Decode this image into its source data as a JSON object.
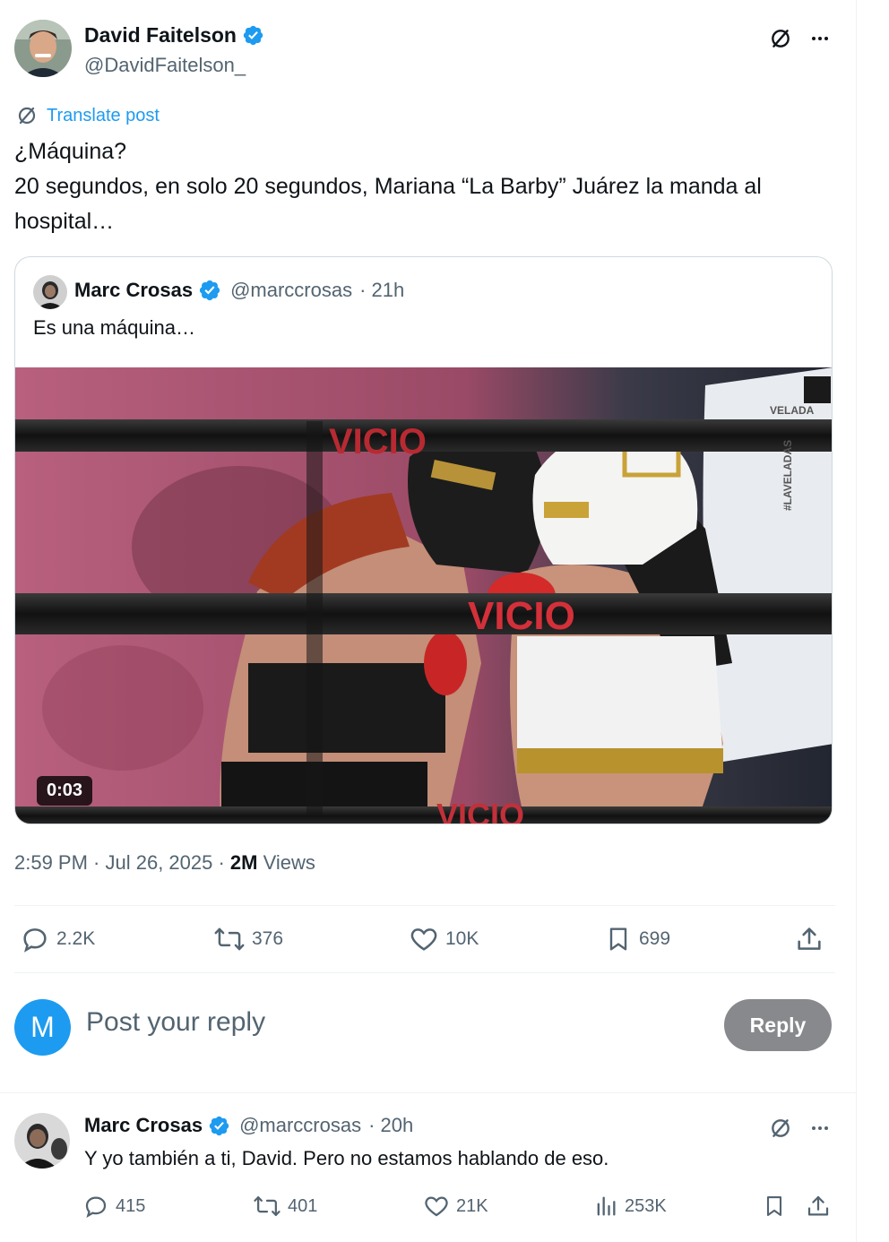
{
  "post": {
    "author_name": "David Faitelson",
    "author_handle": "@DavidFaitelson_",
    "translate_label": "Translate post",
    "text_line1": "¿Máquina?",
    "text_line2": "20 segundos, en solo 20 segundos, Mariana “La Barby” Juárez la manda al hospital…",
    "timestamp": "2:59 PM · Jul 26, 2025 · ",
    "views_count": "2M",
    "views_label": " Views"
  },
  "quote": {
    "author_name": "Marc Crosas",
    "author_handle": "@marccrosas",
    "time": "· 21h",
    "text": "Es una máquina…",
    "video_duration": "0:03",
    "video_banner_text": "VICIO",
    "video_tag": "#LAVELADAS",
    "video_logo": "VELADA"
  },
  "actions": {
    "replies": "2.2K",
    "reposts": "376",
    "likes": "10K",
    "bookmarks": "699"
  },
  "reply_compose": {
    "avatar_letter": "M",
    "placeholder": "Post your reply",
    "button_label": "Reply"
  },
  "comment": {
    "author_name": "Marc Crosas",
    "author_handle": "@marccrosas",
    "time": "· 20h",
    "text": "Y yo también a ti, David. Pero no estamos hablando de eso.",
    "replies": "415",
    "reposts": "401",
    "likes": "21K",
    "views": "253K"
  },
  "colors": {
    "accent": "#1d9bf0",
    "secondary_text": "#536471",
    "reply_button": "#87898c"
  }
}
